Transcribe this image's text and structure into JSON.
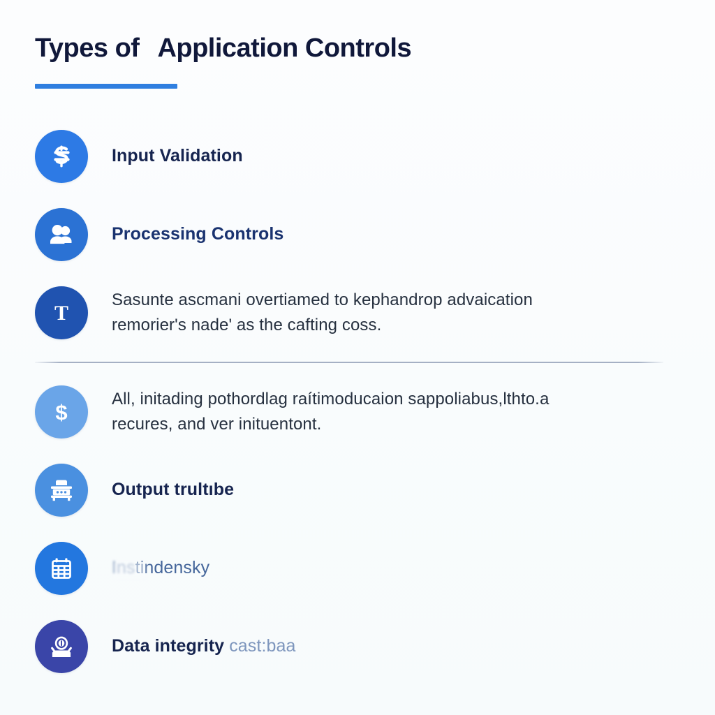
{
  "background_color": "#fbfdfe",
  "header": {
    "title_part_1": "Types of",
    "title_part_2": "Application Controls",
    "title_color": "#10183a",
    "accent_color": "#2f7fe0"
  },
  "divider": {
    "color": "#96a3ba"
  },
  "items": [
    {
      "id": "input-validation",
      "icon": "document-validation-icon",
      "icon_bg": "#2d7ae5",
      "label": "Input Validation",
      "label_color": "#16244f",
      "style": "label"
    },
    {
      "id": "processing-controls",
      "icon": "users-icon",
      "icon_bg": "#2b72d4",
      "label": "Processing Controls",
      "label_color": "#1a3370",
      "style": "label-blue"
    },
    {
      "id": "transaction-note",
      "icon": "letter-t-icon",
      "icon_bg": "#2053b0",
      "paragraph_line_1": "Sasunte ascmani overtiamed to kephandrop advaication",
      "paragraph_line_2": "remorier's nade' as the cafting coss.",
      "paragraph_color": "#26303f",
      "style": "paragraph"
    },
    {
      "id": "cost-note",
      "icon": "dollar-icon",
      "icon_bg": "#6aa5e8",
      "paragraph_line_1": "All, initading pothordlag raítimoducaion sappoliabus,lthto.a",
      "paragraph_line_2": "recures, and ver inituentont.",
      "paragraph_color": "#26303f",
      "style": "paragraph"
    },
    {
      "id": "output-trultibe",
      "icon": "bank-output-icon",
      "icon_bg": "#4a90e0",
      "label": "Output trultıbe",
      "label_color": "#16244f",
      "style": "label"
    },
    {
      "id": "instindensky",
      "icon": "calendar-icon",
      "icon_bg": "#2377df",
      "label_smudged": "Ins",
      "label_rest": "tindensky",
      "label_color": "#46679b",
      "style": "label-steel"
    },
    {
      "id": "data-integrity",
      "icon": "lock-seal-icon",
      "icon_bg": "#3a45a8",
      "label": "Data integrity",
      "label_suffix": "cast:baa",
      "label_color": "#16244f",
      "suffix_color": "#7e96bd",
      "style": "label-with-suffix"
    }
  ]
}
